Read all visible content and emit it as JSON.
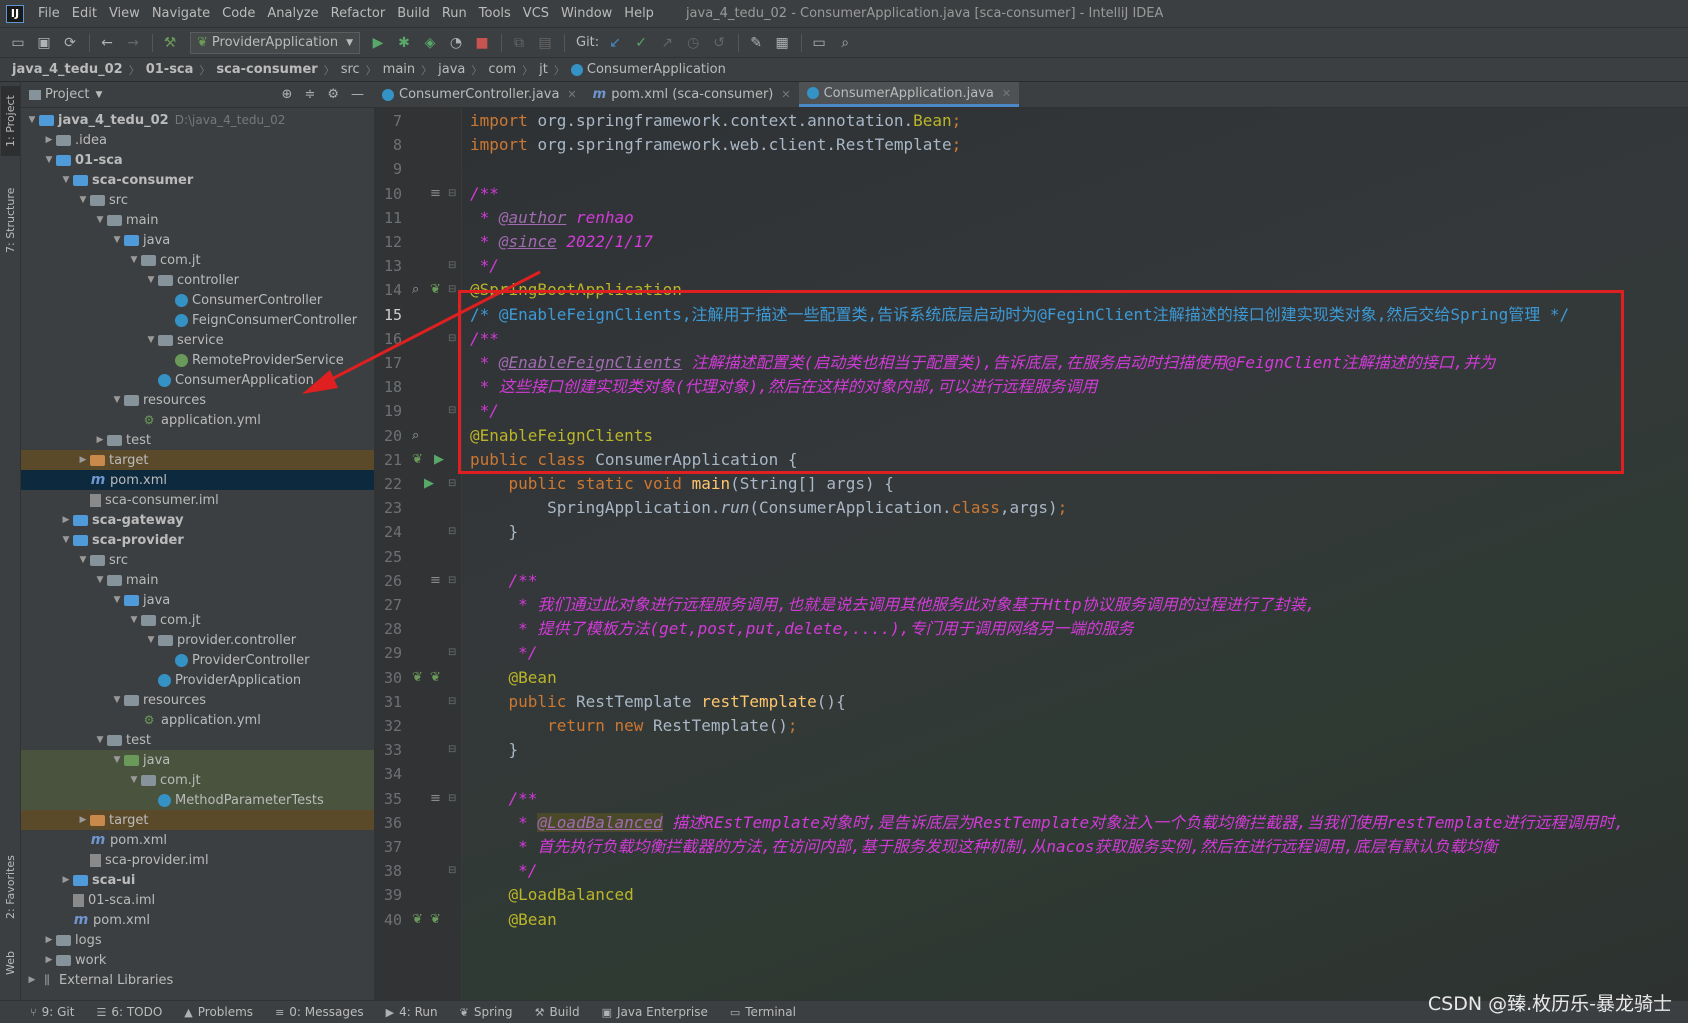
{
  "window": {
    "title": "java_4_tedu_02 - ConsumerApplication.java [sca-consumer] - IntelliJ IDEA",
    "logo": "IJ"
  },
  "menu": [
    "File",
    "Edit",
    "View",
    "Navigate",
    "Code",
    "Analyze",
    "Refactor",
    "Build",
    "Run",
    "Tools",
    "VCS",
    "Window",
    "Help"
  ],
  "toolbar": {
    "run_config": "ProviderApplication",
    "git_label": "Git:"
  },
  "breadcrumb": [
    "java_4_tedu_02",
    "01-sca",
    "sca-consumer",
    "src",
    "main",
    "java",
    "com",
    "jt",
    "ConsumerApplication"
  ],
  "left_stripe": {
    "project": "1: Project",
    "structure": "7: Structure",
    "favorites": "2: Favorites",
    "web": "Web"
  },
  "project_panel": {
    "title": "Project",
    "tree": [
      {
        "label": "java_4_tedu_02",
        "hint": "D:\\java_4_tedu_02",
        "depth": 0,
        "arrow": "down",
        "icon": "folder-blue",
        "bold": true
      },
      {
        "label": ".idea",
        "depth": 1,
        "arrow": "right",
        "icon": "folder"
      },
      {
        "label": "01-sca",
        "depth": 1,
        "arrow": "down",
        "icon": "folder-blue",
        "bold": true
      },
      {
        "label": "sca-consumer",
        "depth": 2,
        "arrow": "down",
        "icon": "folder-blue",
        "bold": true
      },
      {
        "label": "src",
        "depth": 3,
        "arrow": "down",
        "icon": "folder"
      },
      {
        "label": "main",
        "depth": 4,
        "arrow": "down",
        "icon": "folder"
      },
      {
        "label": "java",
        "depth": 5,
        "arrow": "down",
        "icon": "folder-blue"
      },
      {
        "label": "com.jt",
        "depth": 6,
        "arrow": "down",
        "icon": "folder"
      },
      {
        "label": "controller",
        "depth": 7,
        "arrow": "down",
        "icon": "folder"
      },
      {
        "label": "ConsumerController",
        "depth": 8,
        "arrow": "none",
        "icon": "class"
      },
      {
        "label": "FeignConsumerController",
        "depth": 8,
        "arrow": "none",
        "icon": "class"
      },
      {
        "label": "service",
        "depth": 7,
        "arrow": "down",
        "icon": "folder"
      },
      {
        "label": "RemoteProviderService",
        "depth": 8,
        "arrow": "none",
        "icon": "interface"
      },
      {
        "label": "ConsumerApplication",
        "depth": 7,
        "arrow": "none",
        "icon": "class"
      },
      {
        "label": "resources",
        "depth": 5,
        "arrow": "down",
        "icon": "folder"
      },
      {
        "label": "application.yml",
        "depth": 6,
        "arrow": "none",
        "icon": "yml"
      },
      {
        "label": "test",
        "depth": 4,
        "arrow": "right",
        "icon": "folder"
      },
      {
        "label": "target",
        "depth": 3,
        "arrow": "right",
        "icon": "folder-orange",
        "row": "excluded"
      },
      {
        "label": "pom.xml",
        "depth": 3,
        "arrow": "none",
        "icon": "maven",
        "row": "selected"
      },
      {
        "label": "sca-consumer.iml",
        "depth": 3,
        "arrow": "none",
        "icon": "iml"
      },
      {
        "label": "sca-gateway",
        "depth": 2,
        "arrow": "right",
        "icon": "folder-blue",
        "bold": true
      },
      {
        "label": "sca-provider",
        "depth": 2,
        "arrow": "down",
        "icon": "folder-blue",
        "bold": true
      },
      {
        "label": "src",
        "depth": 3,
        "arrow": "down",
        "icon": "folder"
      },
      {
        "label": "main",
        "depth": 4,
        "arrow": "down",
        "icon": "folder"
      },
      {
        "label": "java",
        "depth": 5,
        "arrow": "down",
        "icon": "folder-blue"
      },
      {
        "label": "com.jt",
        "depth": 6,
        "arrow": "down",
        "icon": "folder"
      },
      {
        "label": "provider.controller",
        "depth": 7,
        "arrow": "down",
        "icon": "folder"
      },
      {
        "label": "ProviderController",
        "depth": 8,
        "arrow": "none",
        "icon": "class"
      },
      {
        "label": "ProviderApplication",
        "depth": 7,
        "arrow": "none",
        "icon": "class"
      },
      {
        "label": "resources",
        "depth": 5,
        "arrow": "down",
        "icon": "folder"
      },
      {
        "label": "application.yml",
        "depth": 6,
        "arrow": "none",
        "icon": "yml"
      },
      {
        "label": "test",
        "depth": 4,
        "arrow": "down",
        "icon": "folder"
      },
      {
        "label": "java",
        "depth": 5,
        "arrow": "down",
        "icon": "folder-green",
        "row": "test-bg"
      },
      {
        "label": "com.jt",
        "depth": 6,
        "arrow": "down",
        "icon": "folder",
        "row": "test-bg"
      },
      {
        "label": "MethodParameterTests",
        "depth": 7,
        "arrow": "none",
        "icon": "class",
        "row": "test-bg"
      },
      {
        "label": "target",
        "depth": 3,
        "arrow": "right",
        "icon": "folder-orange",
        "row": "excluded"
      },
      {
        "label": "pom.xml",
        "depth": 3,
        "arrow": "none",
        "icon": "maven"
      },
      {
        "label": "sca-provider.iml",
        "depth": 3,
        "arrow": "none",
        "icon": "iml"
      },
      {
        "label": "sca-ui",
        "depth": 2,
        "arrow": "right",
        "icon": "folder-blue",
        "bold": true
      },
      {
        "label": "01-sca.iml",
        "depth": 2,
        "arrow": "none",
        "icon": "iml"
      },
      {
        "label": "pom.xml",
        "depth": 2,
        "arrow": "none",
        "icon": "maven"
      },
      {
        "label": "logs",
        "depth": 1,
        "arrow": "right",
        "icon": "folder"
      },
      {
        "label": "work",
        "depth": 1,
        "arrow": "right",
        "icon": "folder"
      },
      {
        "label": "External Libraries",
        "depth": 0,
        "arrow": "right",
        "icon": "lib"
      }
    ]
  },
  "editor_tabs": [
    {
      "label": "ConsumerController.java",
      "icon": "class",
      "active": false
    },
    {
      "label": "pom.xml (sca-consumer)",
      "icon": "maven",
      "active": false
    },
    {
      "label": "ConsumerApplication.java",
      "icon": "class",
      "active": true
    }
  ],
  "editor": {
    "current_line": 15,
    "lines": [
      {
        "no": 7,
        "tokens": [
          [
            "kw",
            "import "
          ],
          [
            "gr",
            "org.springframework.context.annotation."
          ],
          [
            "ann",
            "Bean"
          ],
          [
            "kw",
            ";"
          ]
        ]
      },
      {
        "no": 8,
        "tokens": [
          [
            "kw",
            "import "
          ],
          [
            "gr",
            "org.springframework.web.client.RestTemplate"
          ],
          [
            "kw",
            ";"
          ]
        ]
      },
      {
        "no": 9,
        "tokens": []
      },
      {
        "no": 10,
        "tokens": [
          [
            "cm",
            "/**"
          ]
        ]
      },
      {
        "no": 11,
        "tokens": [
          [
            "cm",
            " * "
          ],
          [
            "doc",
            "@author"
          ],
          [
            "cm",
            " renhao"
          ]
        ]
      },
      {
        "no": 12,
        "tokens": [
          [
            "cm",
            " * "
          ],
          [
            "doc",
            "@since"
          ],
          [
            "cm",
            " 2022/1/17"
          ]
        ]
      },
      {
        "no": 13,
        "tokens": [
          [
            "cm",
            " */"
          ]
        ]
      },
      {
        "no": 14,
        "tokens": [
          [
            "ann",
            "@SpringBootApplication"
          ]
        ]
      },
      {
        "no": 15,
        "tokens": [
          [
            "cmp",
            "/* @EnableFeignClients,注解用于描述一些配置类,告诉系统底层启动时为@FeginClient注解描述的接口创建实现类对象,然后交给Spring管理 */"
          ]
        ]
      },
      {
        "no": 16,
        "tokens": [
          [
            "cm",
            "/**"
          ]
        ]
      },
      {
        "no": 17,
        "tokens": [
          [
            "cm",
            " * "
          ],
          [
            "doc",
            "@EnableFeignClients"
          ],
          [
            "cm",
            " 注解描述配置类(启动类也相当于配置类),告诉底层,在服务启动时扫描使用@FeignClient注解描述的接口,并为"
          ]
        ]
      },
      {
        "no": 18,
        "tokens": [
          [
            "cm",
            " * 这些接口创建实现类对象(代理对象),然后在这样的对象内部,可以进行远程服务调用"
          ]
        ]
      },
      {
        "no": 19,
        "tokens": [
          [
            "cm",
            " */"
          ]
        ]
      },
      {
        "no": 20,
        "tokens": [
          [
            "ann",
            "@EnableFeignClients"
          ]
        ]
      },
      {
        "no": 21,
        "tokens": [
          [
            "kw",
            "public class "
          ],
          [
            "gr",
            "ConsumerApplication {"
          ]
        ]
      },
      {
        "no": 22,
        "tokens": [
          [
            "gr",
            "    "
          ],
          [
            "kw",
            "public static void "
          ],
          [
            "fn",
            "main"
          ],
          [
            "gr",
            "(String[] args) {"
          ]
        ]
      },
      {
        "no": 23,
        "tokens": [
          [
            "gr",
            "        SpringApplication."
          ],
          [
            "it",
            "run"
          ],
          [
            "gr",
            "(ConsumerApplication."
          ],
          [
            "kw",
            "class"
          ],
          [
            "gr",
            ",args)"
          ],
          [
            "kw",
            ";"
          ]
        ]
      },
      {
        "no": 24,
        "tokens": [
          [
            "gr",
            "    }"
          ]
        ]
      },
      {
        "no": 25,
        "tokens": []
      },
      {
        "no": 26,
        "tokens": [
          [
            "cm",
            "    /**"
          ]
        ]
      },
      {
        "no": 27,
        "tokens": [
          [
            "cm",
            "     * 我们通过此对象进行远程服务调用,也就是说去调用其他服务此对象基于Http协议服务调用的过程进行了封装,"
          ]
        ]
      },
      {
        "no": 28,
        "tokens": [
          [
            "cm",
            "     * 提供了模板方法(get,post,put,delete,....),专门用于调用网络另一端的服务"
          ]
        ]
      },
      {
        "no": 29,
        "tokens": [
          [
            "cm",
            "     */"
          ]
        ]
      },
      {
        "no": 30,
        "tokens": [
          [
            "gr",
            "    "
          ],
          [
            "ann",
            "@Bean"
          ]
        ]
      },
      {
        "no": 31,
        "tokens": [
          [
            "gr",
            "    "
          ],
          [
            "kw",
            "public "
          ],
          [
            "gr",
            "RestTemplate "
          ],
          [
            "fn",
            "restTemplate"
          ],
          [
            "gr",
            "(){"
          ]
        ]
      },
      {
        "no": 32,
        "tokens": [
          [
            "gr",
            "        "
          ],
          [
            "kw",
            "return new "
          ],
          [
            "gr",
            "RestTemplate()"
          ],
          [
            "kw",
            ";"
          ]
        ]
      },
      {
        "no": 33,
        "tokens": [
          [
            "gr",
            "    }"
          ]
        ]
      },
      {
        "no": 34,
        "tokens": []
      },
      {
        "no": 35,
        "tokens": [
          [
            "cm",
            "    /**"
          ]
        ]
      },
      {
        "no": 36,
        "tokens": [
          [
            "cm",
            "     * "
          ],
          [
            "doch",
            "@LoadBalanced"
          ],
          [
            "cm",
            " 描述REstTemplate对象时,是告诉底层为RestTemplate对象注入一个负载均衡拦截器,当我们使用restTemplate进行远程调用时,"
          ]
        ]
      },
      {
        "no": 37,
        "tokens": [
          [
            "cm",
            "     * 首先执行负载均衡拦截器的方法,在访问内部,基于服务发现这种机制,从nacos获取服务实例,然后在进行远程调用,底层有默认负载均衡"
          ]
        ]
      },
      {
        "no": 38,
        "tokens": [
          [
            "cm",
            "     */"
          ]
        ]
      },
      {
        "no": 39,
        "tokens": [
          [
            "gr",
            "    "
          ],
          [
            "ann",
            "@LoadBalanced"
          ]
        ]
      },
      {
        "no": 40,
        "tokens": [
          [
            "gr",
            "    "
          ],
          [
            "ann",
            "@Bean"
          ]
        ]
      }
    ]
  },
  "statusbar": [
    {
      "label": "9: Git",
      "icon": "git-branch-icon",
      "glyph": "⑂"
    },
    {
      "label": "6: TODO",
      "icon": "todo-icon",
      "glyph": "☰"
    },
    {
      "label": "Problems",
      "icon": "warning-icon",
      "glyph": "▲"
    },
    {
      "label": "0: Messages",
      "icon": "messages-icon",
      "glyph": "≡"
    },
    {
      "label": "4: Run",
      "icon": "run-icon",
      "glyph": "▶"
    },
    {
      "label": "Spring",
      "icon": "spring-icon",
      "glyph": "❦"
    },
    {
      "label": "Build",
      "icon": "build-icon",
      "glyph": "⚒"
    },
    {
      "label": "Java Enterprise",
      "icon": "java-enterprise-icon",
      "glyph": "▣"
    },
    {
      "label": "Terminal",
      "icon": "terminal-icon",
      "glyph": "▭"
    }
  ],
  "watermark": "CSDN @臻.枚历乐-暴龙骑士"
}
